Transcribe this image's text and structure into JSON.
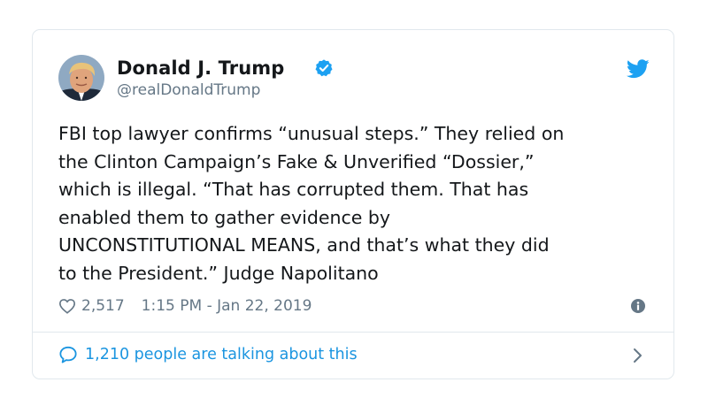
{
  "tweet": {
    "display_name": "Donald J. Trump",
    "handle": "@realDonaldTrump",
    "text": "FBI top lawyer confirms “unusual steps.” They relied on\nthe Clinton Campaign’s Fake & Unverified “Dossier,”\nwhich is illegal. “That has corrupted them. That has\nenabled them to gather evidence by\nUNCONSTITUTIONAL MEANS, and that’s what they did\nto the President.” Judge Napolitano",
    "likes": "2,517",
    "timestamp": "1:15 PM - Jan 22, 2019",
    "talking": "1,210 people are talking about this"
  },
  "colors": {
    "brand_blue": "#1da1f2",
    "link_blue": "#1b95e0",
    "muted_gray": "#657786",
    "border": "#e1e8ed"
  },
  "icons": {
    "verified": "verified-badge-icon",
    "logo": "twitter-bird-icon",
    "like": "heart-icon",
    "info": "info-icon",
    "reply": "speech-bubble-icon",
    "more": "chevron-right-icon"
  }
}
